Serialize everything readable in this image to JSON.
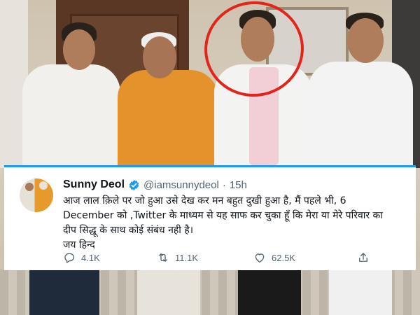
{
  "tweet": {
    "author": {
      "name": "Sunny Deol",
      "handle": "@iamsunnydeol",
      "verified": true
    },
    "separator": "·",
    "timestamp": "15h",
    "text_lines": [
      "आज लाल क़िले पर जो हुआ उसे देख कर मन बहुत दुखी हुआ है, मैं पहले भी, 6",
      "December को ,Twitter के माध्यम से यह साफ कर चुका हूँ कि मेरा या मेरे परिवार का",
      "दीप सिद्धू के साथ कोई संबंध नही है।",
      "जय हिन्द"
    ],
    "stats": {
      "replies": "4.1K",
      "retweets": "11.1K",
      "likes": "62.5K"
    }
  },
  "colors": {
    "accent": "#1d9bf0",
    "annotation_circle": "#e3241b",
    "text_primary": "#0f1419",
    "text_secondary": "#536471"
  },
  "icons": [
    "verified-badge-icon",
    "reply-icon",
    "retweet-icon",
    "like-icon",
    "share-icon"
  ]
}
